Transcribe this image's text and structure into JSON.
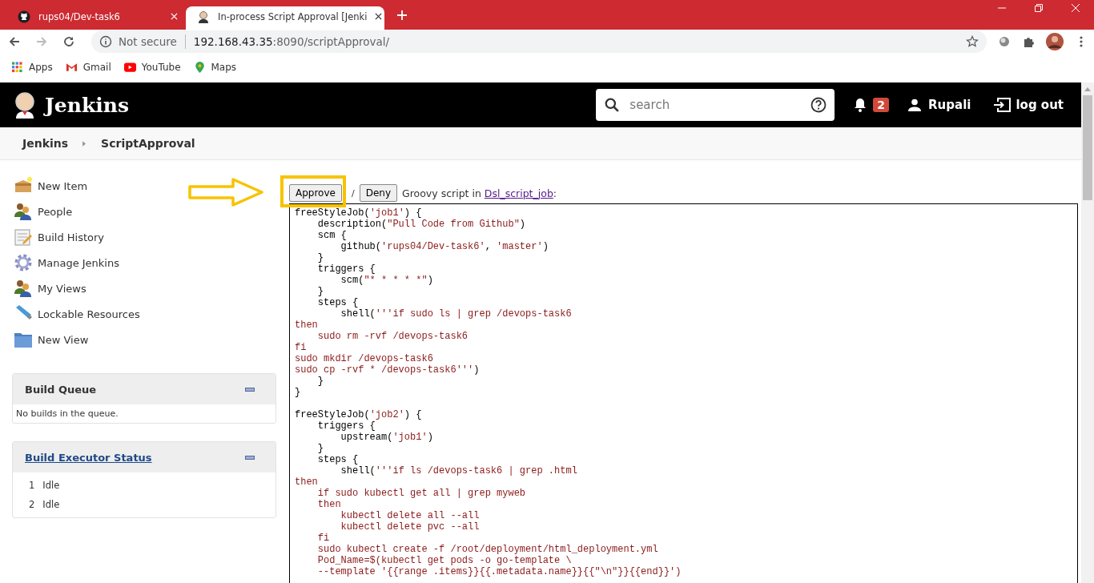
{
  "browser": {
    "tabs": [
      {
        "title": "rups04/Dev-task6",
        "selected": false
      },
      {
        "title": "In-process Script Approval [Jenki",
        "selected": true
      }
    ],
    "address": {
      "security": "Not secure",
      "host": "192.168.43.35",
      "path": ":8090/scriptApproval/"
    },
    "bookmarks": [
      "Apps",
      "Gmail",
      "YouTube",
      "Maps"
    ]
  },
  "header": {
    "brand": "Jenkins",
    "search": {
      "placeholder": "search"
    },
    "notifications": "2",
    "user": "Rupali",
    "logout": "log out"
  },
  "breadcrumbs": [
    "Jenkins",
    "ScriptApproval"
  ],
  "sidebar": {
    "items": [
      "New Item",
      "People",
      "Build History",
      "Manage Jenkins",
      "My Views",
      "Lockable Resources",
      "New View"
    ]
  },
  "build_queue": {
    "title": "Build Queue",
    "message": "No builds in the queue."
  },
  "executors": {
    "title": "Build Executor Status",
    "rows": [
      {
        "number": "1",
        "status": "Idle"
      },
      {
        "number": "2",
        "status": "Idle"
      }
    ]
  },
  "approval": {
    "buttons": [
      "Approve",
      "Deny"
    ],
    "separator": "/",
    "intro": "Groovy script in",
    "job_link": "Dsl_script_job",
    "suffix": ":",
    "blocks": [
      [
        {
          "segments": [
            {
              "text": "freeStyleJob(",
              "kind": "code"
            },
            {
              "text": "'job1'",
              "kind": "string"
            },
            {
              "text": ") {",
              "kind": "code"
            }
          ]
        },
        {
          "segments": [
            {
              "text": "    description(",
              "kind": "code"
            },
            {
              "text": "\"Pull Code from Github\"",
              "kind": "string"
            },
            {
              "text": ")",
              "kind": "code"
            }
          ]
        },
        {
          "segments": [
            {
              "text": "    scm {",
              "kind": "code"
            }
          ]
        },
        {
          "segments": [
            {
              "text": "        github(",
              "kind": "code"
            },
            {
              "text": "'rups04/Dev-task6'",
              "kind": "string"
            },
            {
              "text": ", ",
              "kind": "code"
            },
            {
              "text": "'master'",
              "kind": "string"
            },
            {
              "text": ")",
              "kind": "code"
            }
          ]
        },
        {
          "segments": [
            {
              "text": "    }",
              "kind": "code"
            }
          ]
        },
        {
          "segments": [
            {
              "text": "    triggers {",
              "kind": "code"
            }
          ]
        },
        {
          "segments": [
            {
              "text": "        scm(",
              "kind": "code"
            },
            {
              "text": "\"* * * * *\"",
              "kind": "string"
            },
            {
              "text": ")",
              "kind": "code"
            }
          ]
        },
        {
          "segments": [
            {
              "text": "    }",
              "kind": "code"
            }
          ]
        },
        {
          "segments": [
            {
              "text": "    steps {",
              "kind": "code"
            }
          ]
        },
        {
          "segments": [
            {
              "text": "        shell(",
              "kind": "code"
            },
            {
              "text": "'''if sudo ls | grep /devops-task6",
              "kind": "string"
            }
          ]
        },
        {
          "segments": [
            {
              "text": "then",
              "kind": "string"
            }
          ]
        },
        {
          "segments": [
            {
              "text": "    sudo rm -rvf /devops-task6",
              "kind": "string"
            }
          ]
        },
        {
          "segments": [
            {
              "text": "fi",
              "kind": "string"
            }
          ]
        },
        {
          "segments": [
            {
              "text": "sudo mkdir /devops-task6",
              "kind": "string"
            }
          ]
        },
        {
          "segments": [
            {
              "text": "sudo cp -rvf * /devops-task6'''",
              "kind": "string"
            },
            {
              "text": ")",
              "kind": "code"
            }
          ]
        },
        {
          "segments": [
            {
              "text": "    }",
              "kind": "code"
            }
          ]
        },
        {
          "segments": [
            {
              "text": "}",
              "kind": "code"
            }
          ]
        }
      ],
      [
        {
          "segments": [
            {
              "text": "freeStyleJob(",
              "kind": "code"
            },
            {
              "text": "'job2'",
              "kind": "string"
            },
            {
              "text": ") {",
              "kind": "code"
            }
          ]
        },
        {
          "segments": [
            {
              "text": "    triggers {",
              "kind": "code"
            }
          ]
        },
        {
          "segments": [
            {
              "text": "        upstream(",
              "kind": "code"
            },
            {
              "text": "'job1'",
              "kind": "string"
            },
            {
              "text": ")",
              "kind": "code"
            }
          ]
        },
        {
          "segments": [
            {
              "text": "    }",
              "kind": "code"
            }
          ]
        },
        {
          "segments": [
            {
              "text": "    steps {",
              "kind": "code"
            }
          ]
        },
        {
          "segments": [
            {
              "text": "        shell(",
              "kind": "code"
            },
            {
              "text": "'''if ls /devops-task6 | grep .html",
              "kind": "string"
            }
          ]
        },
        {
          "segments": [
            {
              "text": "then",
              "kind": "string"
            }
          ]
        },
        {
          "segments": [
            {
              "text": "    if sudo kubectl get all | grep myweb",
              "kind": "string"
            }
          ]
        },
        {
          "segments": [
            {
              "text": "    then",
              "kind": "string"
            }
          ]
        },
        {
          "segments": [
            {
              "text": "        kubectl delete all --all",
              "kind": "string"
            }
          ]
        },
        {
          "segments": [
            {
              "text": "        kubectl delete pvc --all",
              "kind": "string"
            }
          ]
        },
        {
          "segments": [
            {
              "text": "    fi",
              "kind": "string"
            }
          ]
        },
        {
          "segments": [
            {
              "text": "    sudo kubectl create -f /root/deployment/html_deployment.yml",
              "kind": "string"
            }
          ]
        },
        {
          "segments": [
            {
              "text": "    Pod_Name=$(kubectl get pods -o go-template \\",
              "kind": "string"
            }
          ]
        },
        {
          "segments": [
            {
              "text": "    --template '{{range .items}}{{.metadata.name}}{{\"\\n\"}}{{end}}')",
              "kind": "string"
            }
          ]
        }
      ]
    ]
  }
}
